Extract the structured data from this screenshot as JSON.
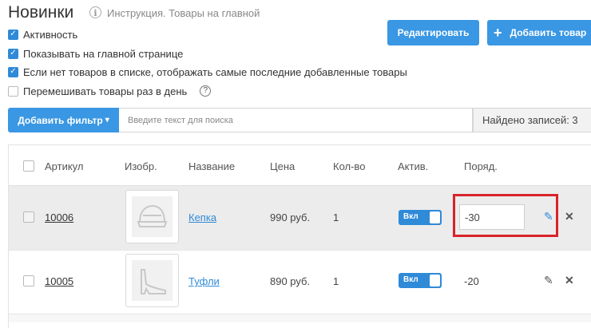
{
  "header": {
    "title": "Новинки",
    "info_icon": "i",
    "info_link": "Инструкция. Товары на главной"
  },
  "settings": [
    {
      "label": "Активность",
      "checked": true
    },
    {
      "label": "Показывать на главной странице",
      "checked": true
    },
    {
      "label": "Если нет товаров в списке, отображать самые последние добавленные товары",
      "checked": true
    },
    {
      "label": "Перемешивать товары раз в день",
      "checked": false
    }
  ],
  "help_icon": "?",
  "toolbar": {
    "edit_label": "Редактировать",
    "add_label": "Добавить товар",
    "add_icon": "+"
  },
  "filter": {
    "button_label": "Добавить фильтр",
    "caret": "▾",
    "search_placeholder": "Введите текст для поиска",
    "found_label": "Найдено записей: 3"
  },
  "table": {
    "columns": [
      "Артикул",
      "Изобр.",
      "Название",
      "Цена",
      "Кол-во",
      "Актив.",
      "Поряд."
    ],
    "rows": [
      {
        "sku": "10006",
        "name": "Кепка",
        "price": "990 руб.",
        "qty": "1",
        "active_label": "Вкл",
        "order": "-30",
        "image_icon": "cap-icon"
      },
      {
        "sku": "10005",
        "name": "Туфли",
        "price": "890 руб.",
        "qty": "1",
        "active_label": "Вкл",
        "order": "-20",
        "image_icon": "shoe-icon"
      }
    ]
  },
  "icons": {
    "edit": "✎",
    "delete": "✕",
    "check": "✓"
  },
  "colors": {
    "accent": "#3a97e3",
    "highlight": "#d9232a",
    "row_hover": "#ececec"
  }
}
